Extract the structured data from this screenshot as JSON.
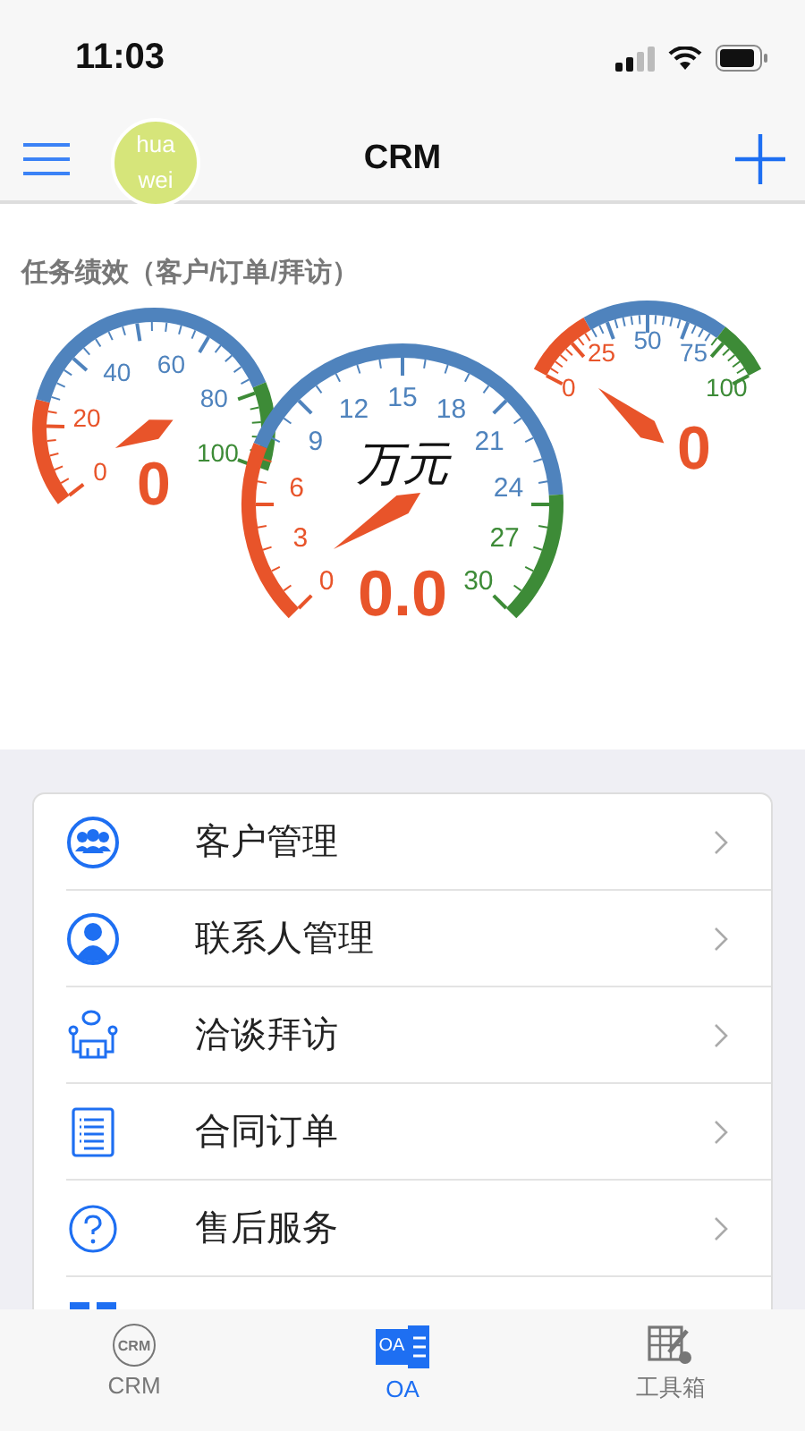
{
  "status_bar": {
    "time": "11:03"
  },
  "header": {
    "title": "CRM",
    "avatar": {
      "line_1": "hua",
      "line_2": "wei"
    }
  },
  "performance": {
    "title": "任务绩效（客户/订单/拜访）",
    "gauges": [
      {
        "value": "0",
        "ticks": [
          "0",
          "20",
          "40",
          "60",
          "80",
          "100"
        ]
      },
      {
        "value": "0.0",
        "unit": "万元",
        "ticks": [
          "0",
          "3",
          "6",
          "9",
          "12",
          "15",
          "18",
          "21",
          "24",
          "27",
          "30"
        ]
      },
      {
        "value": "0",
        "ticks": [
          "0",
          "25",
          "50",
          "75",
          "100"
        ]
      }
    ]
  },
  "menu": [
    {
      "label": "客户管理"
    },
    {
      "label": "联系人管理"
    },
    {
      "label": "洽谈拜访"
    },
    {
      "label": "合同订单"
    },
    {
      "label": "售后服务"
    }
  ],
  "tab_bar": [
    {
      "icon_text": "CRM",
      "label": "CRM",
      "selected": false
    },
    {
      "icon_text": "OA",
      "label": "OA",
      "selected": true
    },
    {
      "label": "工具箱",
      "selected": false
    }
  ]
}
